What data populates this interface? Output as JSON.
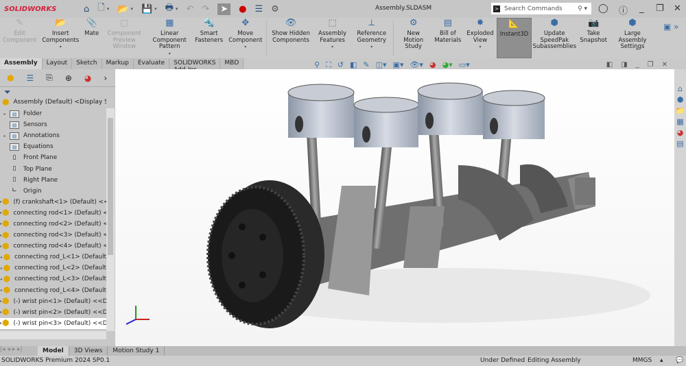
{
  "app": {
    "brand": "SOLIDWORKS",
    "document_title": "Assembly.SLDASM"
  },
  "search": {
    "placeholder": "Search Commands"
  },
  "ribbon": [
    {
      "label": "Edit Component",
      "icon": "edit-component-icon",
      "disabled": true
    },
    {
      "label": "Insert Components",
      "icon": "insert-components-icon",
      "dropdown": true
    },
    {
      "label": "Mate",
      "icon": "paperclip-icon"
    },
    {
      "label": "Component Preview Window",
      "icon": "preview-window-icon",
      "disabled": true
    },
    {
      "label": "Linear Component Pattern",
      "icon": "pattern-icon",
      "dropdown": true
    },
    {
      "label": "Smart Fasteners",
      "icon": "fasteners-icon"
    },
    {
      "label": "Move Component",
      "icon": "move-component-icon",
      "dropdown": true
    },
    {
      "label": "Show Hidden Components",
      "icon": "show-hidden-icon"
    },
    {
      "label": "Assembly Features",
      "icon": "assembly-features-icon",
      "dropdown": true
    },
    {
      "label": "Reference Geometry",
      "icon": "reference-geometry-icon",
      "dropdown": true
    },
    {
      "label": "New Motion Study",
      "icon": "motion-study-icon"
    },
    {
      "label": "Bill of Materials",
      "icon": "bom-icon"
    },
    {
      "label": "Exploded View",
      "icon": "exploded-view-icon",
      "dropdown": true
    },
    {
      "label": "Instant3D",
      "icon": "instant3d-icon",
      "active": true
    },
    {
      "label": "Update SpeedPak Subassemblies",
      "icon": "speedpak-icon"
    },
    {
      "label": "Take Snapshot",
      "icon": "camera-icon"
    },
    {
      "label": "Large Assembly Settings",
      "icon": "large-assembly-icon"
    }
  ],
  "tabs": [
    "Assembly",
    "Layout",
    "Sketch",
    "Markup",
    "Evaluate",
    "SOLIDWORKS Add-Ins",
    "MBD"
  ],
  "tree": {
    "root": "Assembly (Default) <Display State-",
    "items": [
      {
        "label": "Folder",
        "type": "folder",
        "expand": true
      },
      {
        "label": "Sensors",
        "type": "folder"
      },
      {
        "label": "Annotations",
        "type": "folder",
        "expand": true
      },
      {
        "label": "Equations",
        "type": "folder"
      },
      {
        "label": "Front Plane",
        "type": "plane"
      },
      {
        "label": "Top Plane",
        "type": "plane"
      },
      {
        "label": "Right Plane",
        "type": "plane"
      },
      {
        "label": "Origin",
        "type": "origin"
      },
      {
        "label": "(f) crankshaft<1> (Default) <<",
        "type": "comp",
        "expand": true
      },
      {
        "label": "connecting rod<1> (Default) <",
        "type": "comp",
        "expand": true
      },
      {
        "label": "connecting rod<2> (Default) <",
        "type": "comp",
        "expand": true
      },
      {
        "label": "connecting rod<3> (Default) <",
        "type": "comp",
        "expand": true
      },
      {
        "label": "connecting rod<4> (Default) <",
        "type": "comp",
        "expand": true
      },
      {
        "label": "connecting rod_L<1> (Default",
        "type": "comp",
        "expand": true
      },
      {
        "label": "connecting rod_L<2> (Default",
        "type": "comp",
        "expand": true
      },
      {
        "label": "connecting rod_L<3> (Default",
        "type": "comp",
        "expand": true
      },
      {
        "label": "connecting rod_L<4> (Default",
        "type": "comp",
        "expand": true
      },
      {
        "label": "(-) wrist pin<1> (Default) <<D",
        "type": "comp",
        "expand": true
      },
      {
        "label": "(-) wrist pin<2> (Default) <<D",
        "type": "comp",
        "expand": true
      },
      {
        "label": "(-) wrist pin<3> (Default) <<D",
        "type": "comp",
        "expand": true,
        "highlight": true
      }
    ]
  },
  "bottom_tabs": [
    "Model",
    "3D Views",
    "Motion Study 1"
  ],
  "status": {
    "product": "SOLIDWORKS Premium 2024 SP0.1",
    "definition": "Under Defined",
    "mode": "Editing Assembly",
    "units": "MMGS"
  }
}
